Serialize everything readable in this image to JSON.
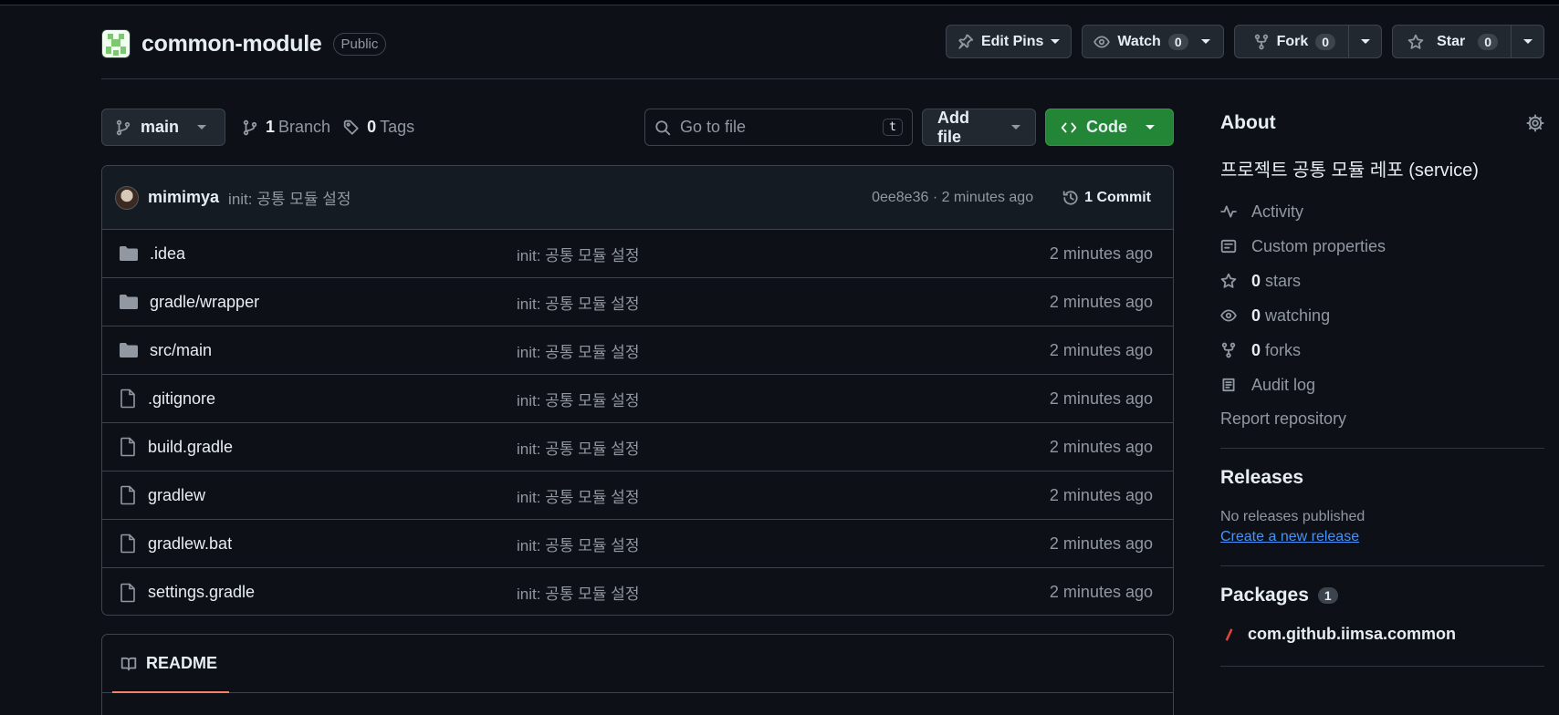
{
  "repo": {
    "name": "common-module",
    "visibility": "Public"
  },
  "header_actions": {
    "edit_pins": "Edit Pins",
    "watch": {
      "label": "Watch",
      "count": "0"
    },
    "fork": {
      "label": "Fork",
      "count": "0"
    },
    "star": {
      "label": "Star",
      "count": "0"
    }
  },
  "file_nav": {
    "branch": "main",
    "branch_count": "1",
    "branch_label": "Branch",
    "tag_count": "0",
    "tag_label": "Tags",
    "goto_placeholder": "Go to file",
    "goto_shortcut": "t",
    "add_file": "Add file",
    "code": "Code"
  },
  "commit": {
    "user": "mimimya",
    "message": "init: 공통 모듈 설정",
    "meta": "0ee8e36 · 2 minutes ago",
    "count_label": "1 Commit"
  },
  "files": [
    {
      "name": ".idea",
      "type": "folder",
      "message": "init: 공통 모듈 설정",
      "time": "2 minutes ago"
    },
    {
      "name": "gradle/wrapper",
      "type": "folder",
      "message": "init: 공통 모듈 설정",
      "time": "2 minutes ago"
    },
    {
      "name": "src/main",
      "type": "folder",
      "message": "init: 공통 모듈 설정",
      "time": "2 minutes ago"
    },
    {
      "name": ".gitignore",
      "type": "file",
      "message": "init: 공통 모듈 설정",
      "time": "2 minutes ago"
    },
    {
      "name": "build.gradle",
      "type": "file",
      "message": "init: 공통 모듈 설정",
      "time": "2 minutes ago"
    },
    {
      "name": "gradlew",
      "type": "file",
      "message": "init: 공통 모듈 설정",
      "time": "2 minutes ago"
    },
    {
      "name": "gradlew.bat",
      "type": "file",
      "message": "init: 공통 모듈 설정",
      "time": "2 minutes ago"
    },
    {
      "name": "settings.gradle",
      "type": "file",
      "message": "init: 공통 모듈 설정",
      "time": "2 minutes ago"
    }
  ],
  "readme": {
    "tab": "README"
  },
  "about": {
    "title": "About",
    "description": "프로젝트 공통 모듈 레포 (service)",
    "activity": "Activity",
    "custom_properties": "Custom properties",
    "stars_count": "0",
    "stars_label": "stars",
    "watching_count": "0",
    "watching_label": "watching",
    "forks_count": "0",
    "forks_label": "forks",
    "audit_log": "Audit log",
    "report": "Report repository"
  },
  "releases": {
    "title": "Releases",
    "empty": "No releases published",
    "create_link": "Create a new release"
  },
  "packages": {
    "title": "Packages",
    "count": "1",
    "item": "com.github.iimsa.common"
  },
  "colors": {
    "accent_green": "#238636",
    "link_blue": "#4493f8",
    "tab_underline": "#f78166",
    "background": "#0d1117"
  }
}
